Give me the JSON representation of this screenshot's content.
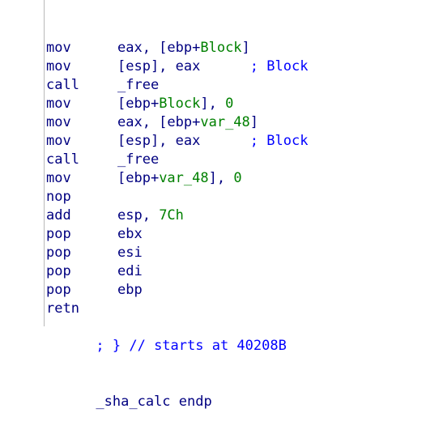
{
  "colors": {
    "code": "#000080",
    "reference": "#008000",
    "comment": "#0000ff",
    "gutter": "#b8b8b8",
    "background": "#ffffff"
  },
  "lines": [
    {
      "mnemonic": "mov",
      "parts": [
        {
          "t": "eax, [ebp+",
          "k": "p"
        },
        {
          "t": "Block",
          "k": "r"
        },
        {
          "t": "]",
          "k": "p"
        }
      ],
      "comment": ""
    },
    {
      "mnemonic": "mov",
      "parts": [
        {
          "t": "[esp], eax",
          "k": "p"
        }
      ],
      "comment": "; Block"
    },
    {
      "mnemonic": "call",
      "parts": [
        {
          "t": "_free",
          "k": "p"
        }
      ],
      "comment": ""
    },
    {
      "mnemonic": "mov",
      "parts": [
        {
          "t": "[ebp+",
          "k": "p"
        },
        {
          "t": "Block",
          "k": "r"
        },
        {
          "t": "], ",
          "k": "p"
        },
        {
          "t": "0",
          "k": "r"
        }
      ],
      "comment": ""
    },
    {
      "mnemonic": "mov",
      "parts": [
        {
          "t": "eax, [ebp+",
          "k": "p"
        },
        {
          "t": "var_48",
          "k": "r"
        },
        {
          "t": "]",
          "k": "p"
        }
      ],
      "comment": ""
    },
    {
      "mnemonic": "mov",
      "parts": [
        {
          "t": "[esp], eax",
          "k": "p"
        }
      ],
      "comment": "; Block"
    },
    {
      "mnemonic": "call",
      "parts": [
        {
          "t": "_free",
          "k": "p"
        }
      ],
      "comment": ""
    },
    {
      "mnemonic": "mov",
      "parts": [
        {
          "t": "[ebp+",
          "k": "p"
        },
        {
          "t": "var_48",
          "k": "r"
        },
        {
          "t": "], ",
          "k": "p"
        },
        {
          "t": "0",
          "k": "r"
        }
      ],
      "comment": ""
    },
    {
      "mnemonic": "nop",
      "parts": [],
      "comment": ""
    },
    {
      "mnemonic": "add",
      "parts": [
        {
          "t": "esp, ",
          "k": "p"
        },
        {
          "t": "7Ch",
          "k": "r"
        }
      ],
      "comment": ""
    },
    {
      "mnemonic": "pop",
      "parts": [
        {
          "t": "ebx",
          "k": "p"
        }
      ],
      "comment": ""
    },
    {
      "mnemonic": "pop",
      "parts": [
        {
          "t": "esi",
          "k": "p"
        }
      ],
      "comment": ""
    },
    {
      "mnemonic": "pop",
      "parts": [
        {
          "t": "edi",
          "k": "p"
        }
      ],
      "comment": ""
    },
    {
      "mnemonic": "pop",
      "parts": [
        {
          "t": "ebp",
          "k": "p"
        }
      ],
      "comment": ""
    },
    {
      "mnemonic": "retn",
      "parts": [],
      "comment": ""
    }
  ],
  "footer_comment": "; } // starts at 40208B",
  "proc_end": "_sha_calc endp"
}
